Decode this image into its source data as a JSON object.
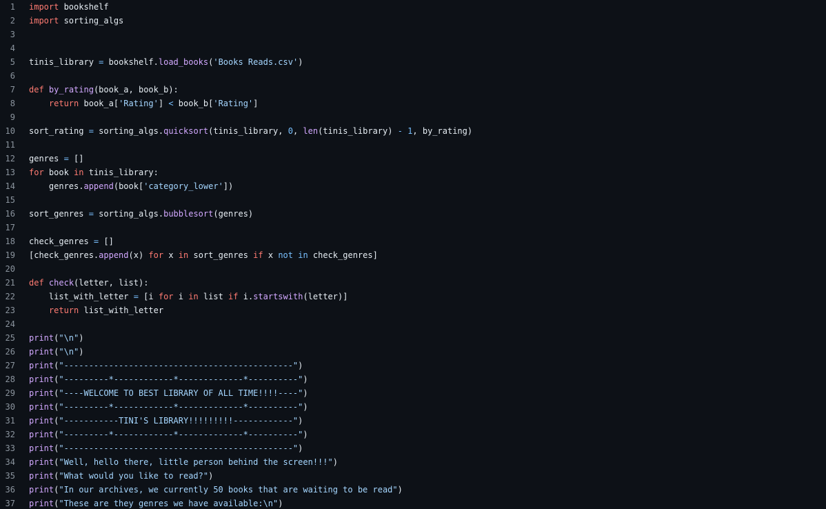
{
  "theme": {
    "background": "#0d1117",
    "line_number": "#8b949e",
    "text": "#e6edf3",
    "keyword": "#ff7b72",
    "function": "#d2a8ff",
    "string": "#a5d6ff",
    "number": "#79c0ff"
  },
  "lines": [
    {
      "n": "1",
      "tokens": [
        {
          "t": "kw",
          "v": "import"
        },
        {
          "t": "tx",
          "v": " bookshelf"
        }
      ]
    },
    {
      "n": "2",
      "tokens": [
        {
          "t": "kw",
          "v": "import"
        },
        {
          "t": "tx",
          "v": " sorting_algs"
        }
      ]
    },
    {
      "n": "3",
      "tokens": []
    },
    {
      "n": "4",
      "tokens": []
    },
    {
      "n": "5",
      "tokens": [
        {
          "t": "tx",
          "v": "tinis_library "
        },
        {
          "t": "op",
          "v": "="
        },
        {
          "t": "tx",
          "v": " bookshelf."
        },
        {
          "t": "fn",
          "v": "load_books"
        },
        {
          "t": "tx",
          "v": "("
        },
        {
          "t": "str",
          "v": "'Books Reads.csv'"
        },
        {
          "t": "tx",
          "v": ")"
        }
      ]
    },
    {
      "n": "6",
      "tokens": []
    },
    {
      "n": "7",
      "tokens": [
        {
          "t": "kw",
          "v": "def"
        },
        {
          "t": "tx",
          "v": " "
        },
        {
          "t": "fn",
          "v": "by_rating"
        },
        {
          "t": "tx",
          "v": "(book_a, book_b):"
        }
      ]
    },
    {
      "n": "8",
      "tokens": [
        {
          "t": "tx",
          "v": "    "
        },
        {
          "t": "kw",
          "v": "return"
        },
        {
          "t": "tx",
          "v": " book_a["
        },
        {
          "t": "str",
          "v": "'Rating'"
        },
        {
          "t": "tx",
          "v": "] "
        },
        {
          "t": "op",
          "v": "<"
        },
        {
          "t": "tx",
          "v": " book_b["
        },
        {
          "t": "str",
          "v": "'Rating'"
        },
        {
          "t": "tx",
          "v": "]"
        }
      ]
    },
    {
      "n": "9",
      "tokens": []
    },
    {
      "n": "10",
      "tokens": [
        {
          "t": "tx",
          "v": "sort_rating "
        },
        {
          "t": "op",
          "v": "="
        },
        {
          "t": "tx",
          "v": " sorting_algs."
        },
        {
          "t": "fn",
          "v": "quicksort"
        },
        {
          "t": "tx",
          "v": "(tinis_library, "
        },
        {
          "t": "num",
          "v": "0"
        },
        {
          "t": "tx",
          "v": ", "
        },
        {
          "t": "fn",
          "v": "len"
        },
        {
          "t": "tx",
          "v": "(tinis_library) "
        },
        {
          "t": "op",
          "v": "-"
        },
        {
          "t": "tx",
          "v": " "
        },
        {
          "t": "num",
          "v": "1"
        },
        {
          "t": "tx",
          "v": ", by_rating)"
        }
      ]
    },
    {
      "n": "11",
      "tokens": []
    },
    {
      "n": "12",
      "tokens": [
        {
          "t": "tx",
          "v": "genres "
        },
        {
          "t": "op",
          "v": "="
        },
        {
          "t": "tx",
          "v": " []"
        }
      ]
    },
    {
      "n": "13",
      "tokens": [
        {
          "t": "kw",
          "v": "for"
        },
        {
          "t": "tx",
          "v": " book "
        },
        {
          "t": "kw",
          "v": "in"
        },
        {
          "t": "tx",
          "v": " tinis_library:"
        }
      ]
    },
    {
      "n": "14",
      "tokens": [
        {
          "t": "tx",
          "v": "    genres."
        },
        {
          "t": "fn",
          "v": "append"
        },
        {
          "t": "tx",
          "v": "(book["
        },
        {
          "t": "str",
          "v": "'category_lower'"
        },
        {
          "t": "tx",
          "v": "])"
        }
      ]
    },
    {
      "n": "15",
      "tokens": []
    },
    {
      "n": "16",
      "tokens": [
        {
          "t": "tx",
          "v": "sort_genres "
        },
        {
          "t": "op",
          "v": "="
        },
        {
          "t": "tx",
          "v": " sorting_algs."
        },
        {
          "t": "fn",
          "v": "bubblesort"
        },
        {
          "t": "tx",
          "v": "(genres)"
        }
      ]
    },
    {
      "n": "17",
      "tokens": []
    },
    {
      "n": "18",
      "tokens": [
        {
          "t": "tx",
          "v": "check_genres "
        },
        {
          "t": "op",
          "v": "="
        },
        {
          "t": "tx",
          "v": " []"
        }
      ]
    },
    {
      "n": "19",
      "tokens": [
        {
          "t": "tx",
          "v": "[check_genres."
        },
        {
          "t": "fn",
          "v": "append"
        },
        {
          "t": "tx",
          "v": "(x) "
        },
        {
          "t": "kw",
          "v": "for"
        },
        {
          "t": "tx",
          "v": " x "
        },
        {
          "t": "kw",
          "v": "in"
        },
        {
          "t": "tx",
          "v": " sort_genres "
        },
        {
          "t": "kw",
          "v": "if"
        },
        {
          "t": "tx",
          "v": " x "
        },
        {
          "t": "op",
          "v": "not"
        },
        {
          "t": "tx",
          "v": " "
        },
        {
          "t": "op",
          "v": "in"
        },
        {
          "t": "tx",
          "v": " check_genres]"
        }
      ]
    },
    {
      "n": "20",
      "tokens": []
    },
    {
      "n": "21",
      "tokens": [
        {
          "t": "kw",
          "v": "def"
        },
        {
          "t": "tx",
          "v": " "
        },
        {
          "t": "fn",
          "v": "check"
        },
        {
          "t": "tx",
          "v": "(letter, list):"
        }
      ]
    },
    {
      "n": "22",
      "tokens": [
        {
          "t": "tx",
          "v": "    list_with_letter "
        },
        {
          "t": "op",
          "v": "="
        },
        {
          "t": "tx",
          "v": " [i "
        },
        {
          "t": "kw",
          "v": "for"
        },
        {
          "t": "tx",
          "v": " i "
        },
        {
          "t": "kw",
          "v": "in"
        },
        {
          "t": "tx",
          "v": " list "
        },
        {
          "t": "kw",
          "v": "if"
        },
        {
          "t": "tx",
          "v": " i."
        },
        {
          "t": "fn",
          "v": "startswith"
        },
        {
          "t": "tx",
          "v": "(letter)]"
        }
      ]
    },
    {
      "n": "23",
      "tokens": [
        {
          "t": "tx",
          "v": "    "
        },
        {
          "t": "kw",
          "v": "return"
        },
        {
          "t": "tx",
          "v": " list_with_letter"
        }
      ]
    },
    {
      "n": "24",
      "tokens": []
    },
    {
      "n": "25",
      "tokens": [
        {
          "t": "fn",
          "v": "print"
        },
        {
          "t": "tx",
          "v": "("
        },
        {
          "t": "str",
          "v": "\"\\n\""
        },
        {
          "t": "tx",
          "v": ")"
        }
      ]
    },
    {
      "n": "26",
      "tokens": [
        {
          "t": "fn",
          "v": "print"
        },
        {
          "t": "tx",
          "v": "("
        },
        {
          "t": "str",
          "v": "\"\\n\""
        },
        {
          "t": "tx",
          "v": ")"
        }
      ]
    },
    {
      "n": "27",
      "tokens": [
        {
          "t": "fn",
          "v": "print"
        },
        {
          "t": "tx",
          "v": "("
        },
        {
          "t": "str",
          "v": "\"----------------------------------------------\""
        },
        {
          "t": "tx",
          "v": ")"
        }
      ]
    },
    {
      "n": "28",
      "tokens": [
        {
          "t": "fn",
          "v": "print"
        },
        {
          "t": "tx",
          "v": "("
        },
        {
          "t": "str",
          "v": "\"---------*------------*-------------*----------\""
        },
        {
          "t": "tx",
          "v": ")"
        }
      ]
    },
    {
      "n": "29",
      "tokens": [
        {
          "t": "fn",
          "v": "print"
        },
        {
          "t": "tx",
          "v": "("
        },
        {
          "t": "str",
          "v": "\"----WELCOME TO BEST LIBRARY OF ALL TIME!!!!----\""
        },
        {
          "t": "tx",
          "v": ")"
        }
      ]
    },
    {
      "n": "30",
      "tokens": [
        {
          "t": "fn",
          "v": "print"
        },
        {
          "t": "tx",
          "v": "("
        },
        {
          "t": "str",
          "v": "\"---------*------------*-------------*----------\""
        },
        {
          "t": "tx",
          "v": ")"
        }
      ]
    },
    {
      "n": "31",
      "tokens": [
        {
          "t": "fn",
          "v": "print"
        },
        {
          "t": "tx",
          "v": "("
        },
        {
          "t": "str",
          "v": "\"-----------TINI'S LIBRARY!!!!!!!!!------------\""
        },
        {
          "t": "tx",
          "v": ")"
        }
      ]
    },
    {
      "n": "32",
      "tokens": [
        {
          "t": "fn",
          "v": "print"
        },
        {
          "t": "tx",
          "v": "("
        },
        {
          "t": "str",
          "v": "\"---------*------------*-------------*----------\""
        },
        {
          "t": "tx",
          "v": ")"
        }
      ]
    },
    {
      "n": "33",
      "tokens": [
        {
          "t": "fn",
          "v": "print"
        },
        {
          "t": "tx",
          "v": "("
        },
        {
          "t": "str",
          "v": "\"----------------------------------------------\""
        },
        {
          "t": "tx",
          "v": ")"
        }
      ]
    },
    {
      "n": "34",
      "tokens": [
        {
          "t": "fn",
          "v": "print"
        },
        {
          "t": "tx",
          "v": "("
        },
        {
          "t": "str",
          "v": "\"Well, hello there, little person behind the screen!!!\""
        },
        {
          "t": "tx",
          "v": ")"
        }
      ]
    },
    {
      "n": "35",
      "tokens": [
        {
          "t": "fn",
          "v": "print"
        },
        {
          "t": "tx",
          "v": "("
        },
        {
          "t": "str",
          "v": "\"What would you like to read?\""
        },
        {
          "t": "tx",
          "v": ")"
        }
      ]
    },
    {
      "n": "36",
      "tokens": [
        {
          "t": "fn",
          "v": "print"
        },
        {
          "t": "tx",
          "v": "("
        },
        {
          "t": "str",
          "v": "\"In our archives, we currently 50 books that are waiting to be read\""
        },
        {
          "t": "tx",
          "v": ")"
        }
      ]
    },
    {
      "n": "37",
      "tokens": [
        {
          "t": "fn",
          "v": "print"
        },
        {
          "t": "tx",
          "v": "("
        },
        {
          "t": "str",
          "v": "\"These are they genres we have available:\\n\""
        },
        {
          "t": "tx",
          "v": ")"
        }
      ]
    }
  ]
}
